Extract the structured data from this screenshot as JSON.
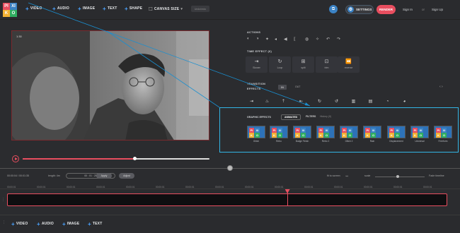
{
  "logo": {
    "letters": [
      "PI",
      "XI",
      "K",
      "O"
    ],
    "colors": [
      "#e84e5f",
      "#3b82c4",
      "#f2b134",
      "#2fae60"
    ]
  },
  "toolbar": {
    "video": "VIDEO",
    "audio": "AUDIO",
    "image": "IMAGE",
    "text": "TEXT",
    "shape": "SHAPE",
    "canvas_size": "CANVAS SIZE",
    "undo": "Undo/redo",
    "settings": "SETTINGS",
    "render": "RENDER",
    "sign_in": "Sign In",
    "or": "or",
    "sign_up": "Sign Up"
  },
  "player": {
    "time": "1:30",
    "progress": 0.6
  },
  "actions": {
    "label": "ACTIONS"
  },
  "time_effects": {
    "label": "TIME EFFECT (6)",
    "items": [
      {
        "label": "Slower",
        "icon": "slow-icon"
      },
      {
        "label": "Loop",
        "icon": "loop-icon"
      },
      {
        "label": "split",
        "icon": "split-icon"
      },
      {
        "label": "trim",
        "icon": "trim-icon"
      },
      {
        "label": "reverse",
        "icon": "reverse-icon"
      }
    ]
  },
  "transition": {
    "label": "TRANSITION",
    "effects_label": "EFFECTS",
    "in": "IN",
    "out": "OUT",
    "pager": "‹ ›"
  },
  "graphic_effects": {
    "label": "GRAPHIC EFFECTS",
    "tab_animated": "ANIMATED",
    "tab_filters": "FILTERS",
    "tab_history": "History (0)",
    "items": [
      "Glitch",
      "Retro",
      "Budge Finish",
      "Retro 2",
      "Glitch 2",
      "Rain",
      "Displacement",
      "Universal",
      "Freeform"
    ]
  },
  "timeline": {
    "time": "00:00:04 / 00:01:35",
    "length_label": "length: 4m",
    "timecode": "00 : 01 : 25",
    "apply": "Apply",
    "adjust": "Adjust",
    "fit": "fit to screen",
    "scale": "scale",
    "fade": "Fade timeline",
    "ticks": [
      "00:00:01",
      "00:00:01",
      "00:00:01",
      "00:00:01",
      "00:00:01",
      "00:00:01",
      "00:00:01",
      "00:00:01",
      "00:00:01",
      "00:00:01",
      "00:00:01",
      "00:00:01",
      "00:00:01",
      "00:00:01",
      "00:00:01"
    ],
    "playhead": 0.636
  },
  "bottom": {
    "video": "VIDEO",
    "audio": "AUDIO",
    "image": "IMAGE",
    "text": "TEXT"
  }
}
